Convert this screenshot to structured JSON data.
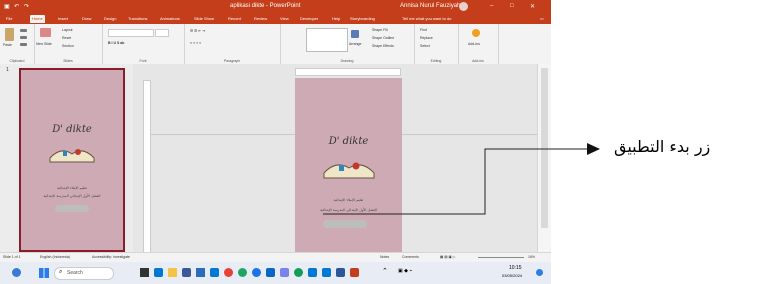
{
  "window": {
    "title": "aplikasi dikte - PowerPoint",
    "account": "Annisa Nurul Fauziyah"
  },
  "ribbon_tabs": [
    "File",
    "Home",
    "Insert",
    "Draw",
    "Design",
    "Transitions",
    "Animations",
    "Slide Show",
    "Record",
    "Review",
    "View",
    "Developer",
    "Help",
    "Storyboarding"
  ],
  "tell_me": "Tell me what you want to do",
  "ribbon_groups": {
    "clipboard": {
      "label": "Clipboard",
      "paste": "Paste"
    },
    "slides": {
      "label": "Slides",
      "new_slide": "New Slide",
      "layout": "Layout",
      "reset": "Reset",
      "section": "Section"
    },
    "font": {
      "label": "Font"
    },
    "paragraph": {
      "label": "Paragraph"
    },
    "drawing": {
      "label": "Drawing",
      "arrange": "Arrange",
      "quick_styles": "Quick Styles",
      "shape_fill": "Shape Fill",
      "shape_outline": "Shape Outline",
      "shape_effects": "Shape Effects"
    },
    "editing": {
      "label": "Editing",
      "find": "Find",
      "replace": "Replace",
      "select": "Select"
    },
    "addins": {
      "label": "Add-ins",
      "addins": "Add-ins"
    }
  },
  "slide": {
    "title": "D' dikte",
    "line1": "تعليم الإملاء الإبتدائية",
    "line2": "الفصل الأول الإبتدائي المدرسة الإبتدائية"
  },
  "status": {
    "slide_num": "Slide 1 of 1",
    "language": "English (Indonesia)",
    "accessibility": "Accessibility: Investigate",
    "notes": "Notes",
    "comments": "Comments",
    "zoom": "16%"
  },
  "taskbar": {
    "search": "Search",
    "time": "10:15",
    "date": "03/05/2024"
  },
  "annotation": {
    "text": "زر بدء التطبيق"
  },
  "colors": {
    "accent": "#c43e1c",
    "slide_bg": "#cdaab4",
    "thumb_border": "#8a1c2b"
  }
}
